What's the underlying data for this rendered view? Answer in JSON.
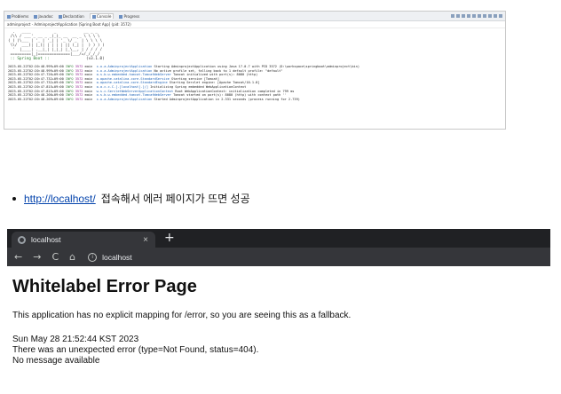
{
  "eclipse": {
    "tabs": [
      "Problems",
      "Javadoc",
      "Declaration",
      "Console",
      "Progress"
    ],
    "active_tab": "Console",
    "path": "adminproject - AdminprojectApplication [Spring Boot App]  (pid: 3572)",
    "banner_lines": [
      "  .   ____          _            __ _ _",
      " /\\\\ / ___'_ __ _ _(_)_ __  __ _ \\ \\ \\ \\",
      "( ( )\\___ | '_ | '_| | '_ \\/ _` | \\ \\ \\ \\",
      " \\\\/  ___)| |_)| | | | | || (_| |  ) ) ) )",
      "  '  |____| .__|_| |_|_| |_\\__, | / / / /",
      " =========|_|==============|___/=/_/_/_/"
    ],
    "banner_spring": " :: Spring Boot ::",
    "banner_version": "(v3.1.0)",
    "log": [
      {
        "ts": "2023-05-22T02:20:48.999+09:00",
        "lvl": "INFO",
        "pid": "3572",
        "th": "main",
        "cls": "c.o.a.AdminprojectApplication",
        "msg": "Starting AdminprojectApplication using Java 17.0.7 with PID 3572 (D:\\workspace\\springboot\\adminproject\\bin)"
      },
      {
        "ts": "2023-05-22T02:20:48.999+09:00",
        "lvl": "INFO",
        "pid": "3572",
        "th": "main",
        "cls": "c.o.a.AdminprojectApplication",
        "msg": "No active profile set, falling back to 1 default profile: \"default\""
      },
      {
        "ts": "2023-05-22T02:20:47.726+09:00",
        "lvl": "INFO",
        "pid": "3572",
        "th": "main",
        "cls": "o.s.b.w.embedded.tomcat.TomcatWebServer",
        "msg": "Tomcat initialized with port(s): 8080 (http)"
      },
      {
        "ts": "2023-05-22T02:20:47.732+09:00",
        "lvl": "INFO",
        "pid": "3572",
        "th": "main",
        "cls": "o.apache.catalina.core.StandardService",
        "msg": "Starting service [Tomcat]"
      },
      {
        "ts": "2023-05-22T02:20:47.732+09:00",
        "lvl": "INFO",
        "pid": "3572",
        "th": "main",
        "cls": "o.apache.catalina.core.StandardEngine",
        "msg": "Starting Servlet engine: [Apache Tomcat/10.1.8]"
      },
      {
        "ts": "2023-05-22T02:20:47.815+09:00",
        "lvl": "INFO",
        "pid": "3572",
        "th": "main",
        "cls": "o.a.c.c.C.[.[localhost].[/]",
        "msg": "Initializing Spring embedded WebApplicationContext"
      },
      {
        "ts": "2023-05-22T02:20:47.815+09:00",
        "lvl": "INFO",
        "pid": "3572",
        "th": "main",
        "cls": "w.s.c.ServletWebServerApplicationContext",
        "msg": "Root WebApplicationContext: initialization completed in 799 ms"
      },
      {
        "ts": "2023-05-22T02:20:48.200+09:00",
        "lvl": "INFO",
        "pid": "3572",
        "th": "main",
        "cls": "o.s.b.w.embedded.tomcat.TomcatWebServer",
        "msg": "Tomcat started on port(s): 8080 (http) with context path ''"
      },
      {
        "ts": "2023-05-22T02:20:48.209+09:00",
        "lvl": "INFO",
        "pid": "3572",
        "th": "main",
        "cls": "c.o.a.AdminprojectApplication",
        "msg": "Started AdminprojectApplication in 2.331 seconds (process running for 2.739)"
      }
    ]
  },
  "bullet": {
    "link": "http://localhost/",
    "text": "접속해서 에러 페이지가 뜨면 성공"
  },
  "browser": {
    "tab_title": "localhost",
    "tab_close": "×",
    "new_tab": "+",
    "nav_back": "←",
    "nav_forward": "→",
    "nav_reload": "C",
    "nav_home": "⌂",
    "info_glyph": "i",
    "address": "localhost"
  },
  "page": {
    "title": "Whitelabel Error Page",
    "description": "This application has no explicit mapping for /error, so you are seeing this as a fallback.",
    "lines": [
      "Sun May 28 21:52:44 KST 2023",
      "There was an unexpected error (type=Not Found, status=404).",
      "No message available"
    ]
  }
}
